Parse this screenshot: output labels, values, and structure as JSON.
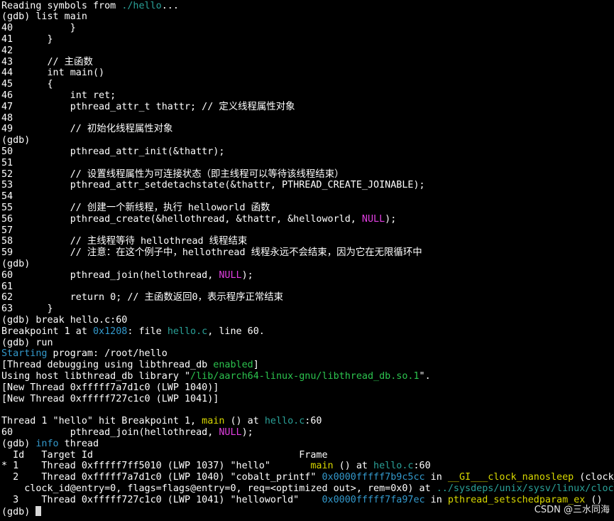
{
  "colors": {
    "fg": "#ffffff",
    "path": "#2aa198",
    "address": "#3399cc",
    "function": "#d7d700",
    "keyword": "#e23fe2",
    "string": "#2cc44f",
    "starting": "#3399cc"
  },
  "lines": [
    [
      {
        "t": "Reading symbols from "
      },
      {
        "t": "./hello",
        "c": "path"
      },
      {
        "t": "..."
      }
    ],
    [
      {
        "t": "(gdb) list main"
      }
    ],
    [
      {
        "t": "40          }"
      }
    ],
    [
      {
        "t": "41      }"
      }
    ],
    [
      {
        "t": "42"
      }
    ],
    [
      {
        "t": "43      // 主函数"
      }
    ],
    [
      {
        "t": "44      int main()"
      }
    ],
    [
      {
        "t": "45      {"
      }
    ],
    [
      {
        "t": "46          int ret;"
      }
    ],
    [
      {
        "t": "47          pthread_attr_t thattr; // 定义线程属性对象"
      }
    ],
    [
      {
        "t": "48"
      }
    ],
    [
      {
        "t": "49          // 初始化线程属性对象"
      }
    ],
    [
      {
        "t": "(gdb)"
      }
    ],
    [
      {
        "t": "50          pthread_attr_init(&thattr);"
      }
    ],
    [
      {
        "t": "51"
      }
    ],
    [
      {
        "t": "52          // 设置线程属性为可连接状态（即主线程可以等待该线程结束）"
      }
    ],
    [
      {
        "t": "53          pthread_attr_setdetachstate(&thattr, PTHREAD_CREATE_JOINABLE);"
      }
    ],
    [
      {
        "t": "54"
      }
    ],
    [
      {
        "t": "55          // 创建一个新线程，执行 helloworld 函数"
      }
    ],
    [
      {
        "t": "56          pthread_create(&hellothread, &thattr, &helloworld, "
      },
      {
        "t": "NULL",
        "c": "keyword"
      },
      {
        "t": ");"
      }
    ],
    [
      {
        "t": "57"
      }
    ],
    [
      {
        "t": "58          // 主线程等待 hellothread 线程结束"
      }
    ],
    [
      {
        "t": "59          // 注意：在这个例子中，hellothread 线程永远不会结束，因为它在无限循环中"
      }
    ],
    [
      {
        "t": "(gdb)"
      }
    ],
    [
      {
        "t": "60          pthread_join(hellothread, "
      },
      {
        "t": "NULL",
        "c": "keyword"
      },
      {
        "t": ");"
      }
    ],
    [
      {
        "t": "61"
      }
    ],
    [
      {
        "t": "62          return 0; // 主函数返回0，表示程序正常结束"
      }
    ],
    [
      {
        "t": "63      }"
      }
    ],
    [
      {
        "t": "(gdb) break hello.c:60"
      }
    ],
    [
      {
        "t": "Breakpoint 1 at "
      },
      {
        "t": "0x1208",
        "c": "address"
      },
      {
        "t": ": file "
      },
      {
        "t": "hello.c",
        "c": "path"
      },
      {
        "t": ", line 60."
      }
    ],
    [
      {
        "t": "(gdb) run"
      }
    ],
    [
      {
        "t": "Starting",
        "c": "starting"
      },
      {
        "t": " program: /root/hello"
      }
    ],
    [
      {
        "t": "[Thread debugging using libthread_db "
      },
      {
        "t": "enabled",
        "c": "string"
      },
      {
        "t": "]"
      }
    ],
    [
      {
        "t": "Using host libthread_db library \""
      },
      {
        "t": "/lib/aarch64-linux-gnu/libthread_db.so.1",
        "c": "string"
      },
      {
        "t": "\"."
      }
    ],
    [
      {
        "t": "[New Thread 0xfffff7a7d1c0 (LWP 1040)]"
      }
    ],
    [
      {
        "t": "[New Thread 0xfffff727c1c0 (LWP 1041)]"
      }
    ],
    [
      {
        "t": ""
      }
    ],
    [
      {
        "t": "Thread 1 \"hello\" hit Breakpoint 1, "
      },
      {
        "t": "main",
        "c": "function"
      },
      {
        "t": " () at "
      },
      {
        "t": "hello.c",
        "c": "path"
      },
      {
        "t": ":60"
      }
    ],
    [
      {
        "t": "60          pthread_join(hellothread, "
      },
      {
        "t": "NULL",
        "c": "keyword"
      },
      {
        "t": ");"
      }
    ],
    [
      {
        "t": "(gdb) "
      },
      {
        "t": "info",
        "c": "address"
      },
      {
        "t": " thread"
      }
    ],
    [
      {
        "t": "  Id   Target Id                                    Frame"
      }
    ],
    [
      {
        "t": "* 1    Thread 0xfffff7ff5010 (LWP 1037) \"hello\"       "
      },
      {
        "t": "main",
        "c": "function"
      },
      {
        "t": " () at "
      },
      {
        "t": "hello.c",
        "c": "path"
      },
      {
        "t": ":60"
      }
    ],
    [
      {
        "t": "  2    Thread 0xfffff7a7d1c0 (LWP 1040) \"cobalt_printf\" "
      },
      {
        "t": "0x0000fffff7b9c5cc",
        "c": "address"
      },
      {
        "t": " in "
      },
      {
        "t": "__GI___clock_nanosleep",
        "c": "function"
      },
      {
        "t": " (clock_id=clock"
      }
    ],
    [
      {
        "t": "    clock_id@entry=0, flags=flags@entry=0, req=<optimized out>, rem=0x0) at "
      },
      {
        "t": "../sysdeps/unix/sysv/linux/clock_nanosleep.c",
        "c": "path"
      }
    ],
    [
      {
        "t": "  3    Thread 0xfffff727c1c0 (LWP 1041) \"helloworld\"    "
      },
      {
        "t": "0x0000fffff7fa97ec",
        "c": "address"
      },
      {
        "t": " in "
      },
      {
        "t": "pthread_setschedparam_ex",
        "c": "function"
      },
      {
        "t": " ()"
      }
    ],
    [
      {
        "t": "(gdb) "
      }
    ]
  ],
  "watermark": "CSDN @三水同海"
}
